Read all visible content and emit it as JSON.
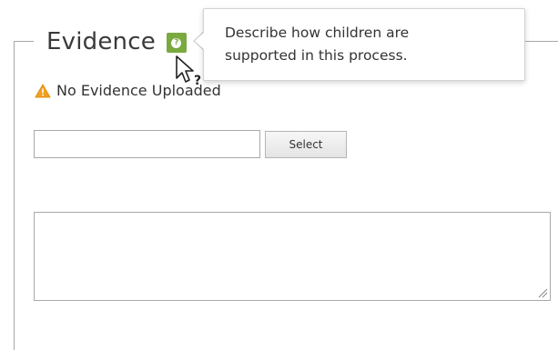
{
  "section": {
    "title": "Evidence",
    "help_icon": "help-question-icon"
  },
  "tooltip": {
    "line1": "Describe how children are",
    "line2": "supported in this process."
  },
  "status": {
    "icon": "warning-icon",
    "text": "No Evidence Uploaded",
    "icon_color": "#f0a020"
  },
  "file_picker": {
    "value": "",
    "placeholder": "",
    "select_label": "Select"
  },
  "notes": {
    "value": "",
    "placeholder": ""
  },
  "colors": {
    "help_icon_bg": "#79a93f",
    "border": "#a8a8a8"
  }
}
